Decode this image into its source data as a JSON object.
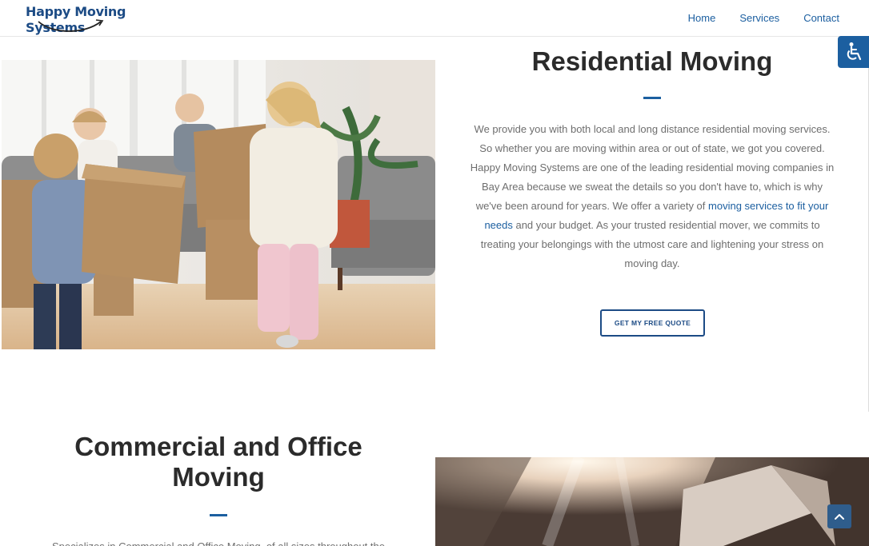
{
  "header": {
    "logo_text": "Happy Moving Systems",
    "nav": [
      {
        "label": "Home"
      },
      {
        "label": "Services"
      },
      {
        "label": "Contact"
      }
    ]
  },
  "residential": {
    "title": "Residential Moving",
    "paragraph_before_link": "We provide you with both local and long distance residential moving services. So whether you are moving within area or out of state, we got you covered. Happy Moving Systems are one of the leading residential moving companies in Bay Area because we sweat the details so you don't have to, which is why we've been around for years. We offer a variety of ",
    "link_text": "moving services to fit your needs",
    "paragraph_after_link": " and your budget. As your trusted residential mover, we commits to treating your belongings with the utmost care and lightening your stress on moving day.",
    "cta_label": "GET MY FREE QUOTE"
  },
  "commercial": {
    "title": "Commercial and Office Moving",
    "paragraph": "Specializes in Commercial and Office Moving, of all sizes throughout the"
  },
  "icons": {
    "accessibility": "wheelchair-icon",
    "scroll_top": "chevron-up-icon"
  },
  "colors": {
    "brand_blue": "#1c5fa0",
    "brand_dark_blue": "#1c4b85",
    "heading": "#2b2b2b",
    "body_text": "#6e6e6e"
  }
}
